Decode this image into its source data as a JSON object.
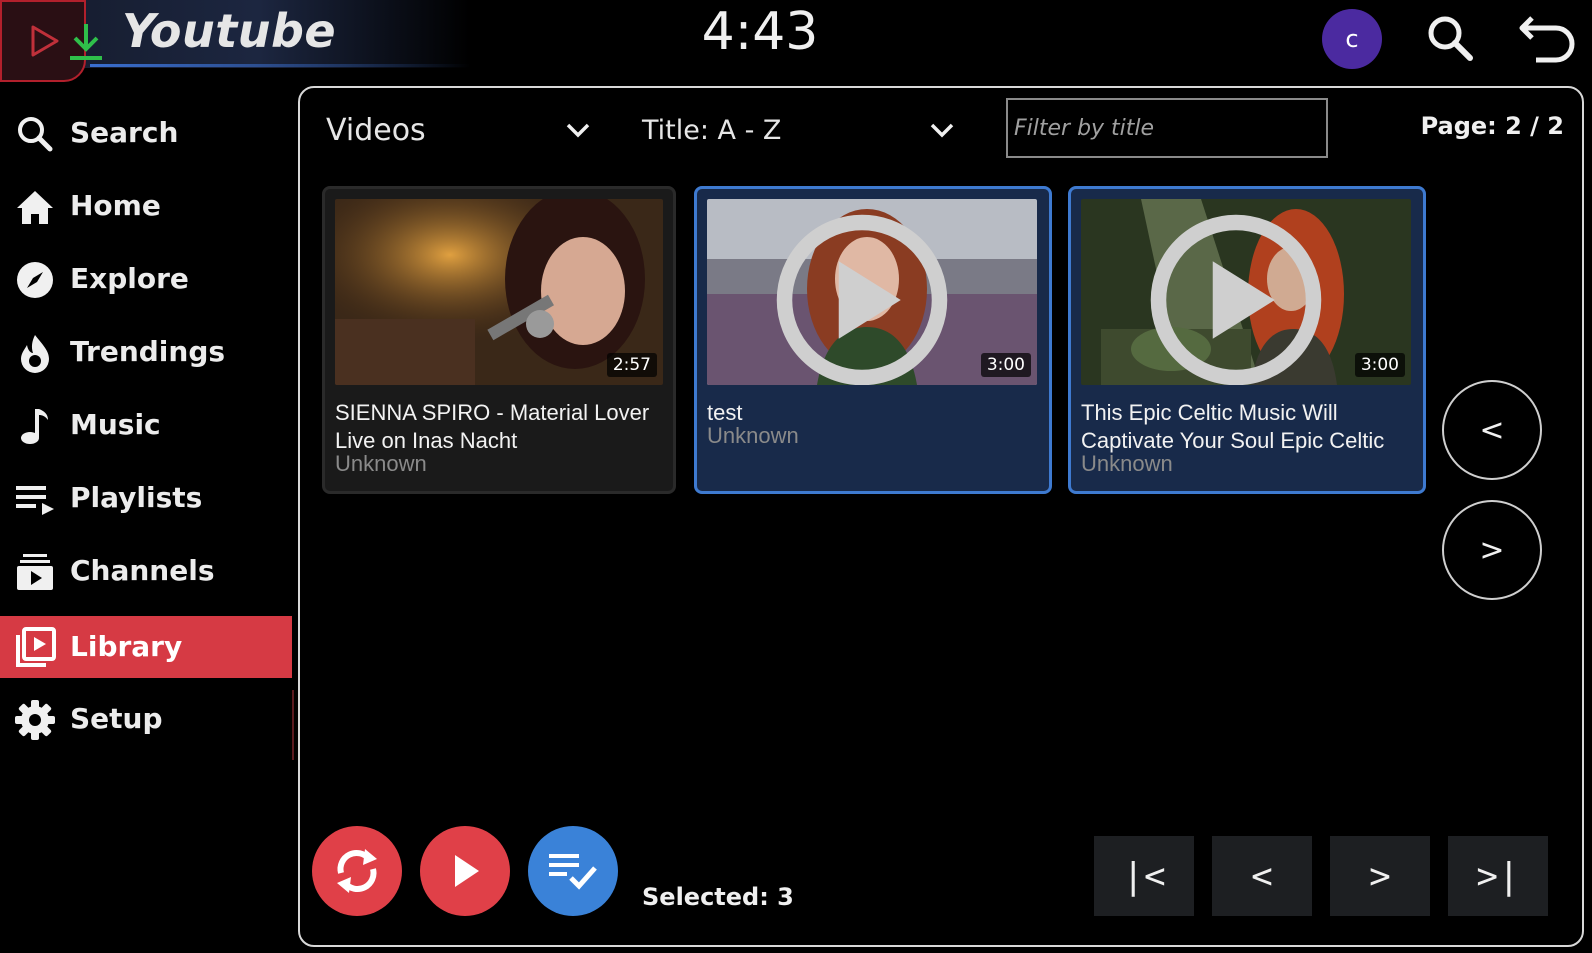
{
  "header": {
    "app_title": "Youtube",
    "clock": "4:43",
    "avatar_letter": "c",
    "accent_color": "#d63a44"
  },
  "sidebar": {
    "items": [
      {
        "label": "Search",
        "icon": "search-icon"
      },
      {
        "label": "Home",
        "icon": "home-icon"
      },
      {
        "label": "Explore",
        "icon": "compass-icon"
      },
      {
        "label": "Trendings",
        "icon": "flame-icon"
      },
      {
        "label": "Music",
        "icon": "music-note-icon"
      },
      {
        "label": "Playlists",
        "icon": "playlist-icon"
      },
      {
        "label": "Channels",
        "icon": "channels-icon"
      },
      {
        "label": "Library",
        "icon": "library-icon",
        "active": true
      },
      {
        "label": "Setup",
        "icon": "gear-icon"
      }
    ]
  },
  "toolbar": {
    "type_select": "Videos",
    "sort_select": "Title: A - Z",
    "filter_placeholder": "Filter by title",
    "page_info": "Page: 2 / 2"
  },
  "videos": [
    {
      "title": "SIENNA SPIRO - Material Lover Live on Inas Nacht",
      "author": "Unknown",
      "duration": "2:57",
      "selected": false
    },
    {
      "title": "test",
      "author": "Unknown",
      "duration": "3:00",
      "selected": true
    },
    {
      "title": "This Epic Celtic Music Will Captivate Your Soul Epic Celtic",
      "author": "Unknown",
      "duration": "3:00",
      "selected": true
    }
  ],
  "side_nav": {
    "prev": "<",
    "next": ">"
  },
  "actions": {
    "selected_text": "Selected: 3",
    "selected_color": "#3a82d8"
  },
  "pagination": {
    "first": "|<",
    "prev": "<",
    "next": ">",
    "last": ">|"
  }
}
